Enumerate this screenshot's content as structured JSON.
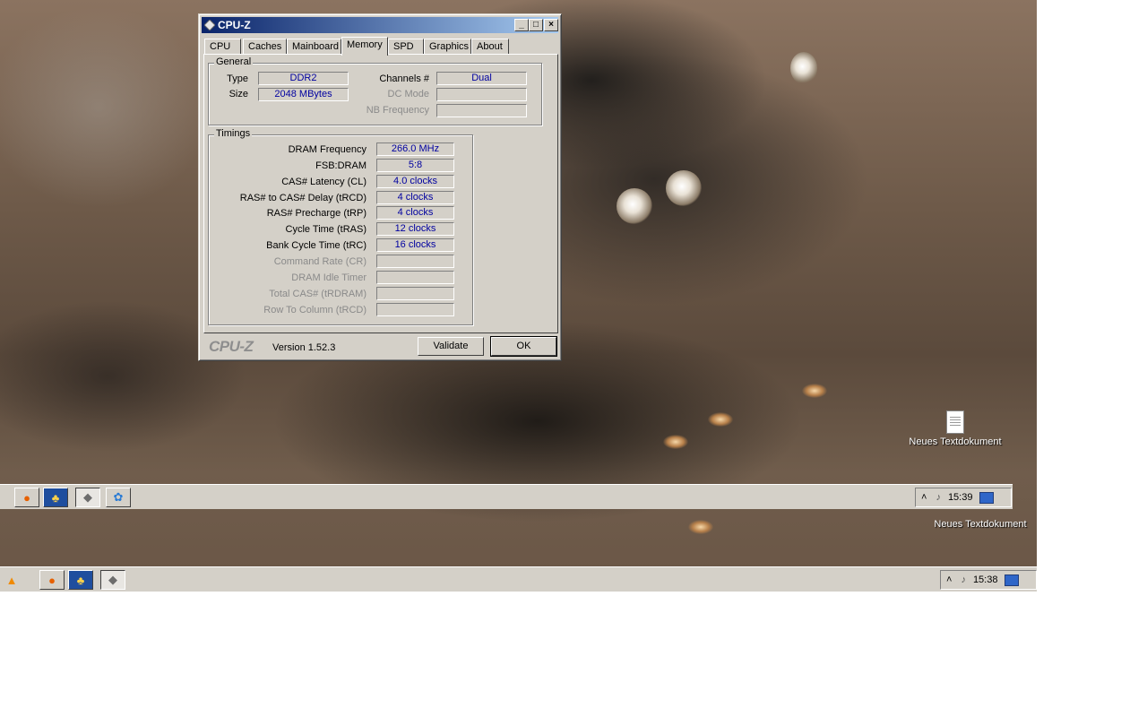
{
  "window": {
    "title": "CPU-Z",
    "tabs": [
      "CPU",
      "Caches",
      "Mainboard",
      "Memory",
      "SPD",
      "Graphics",
      "About"
    ],
    "active_tab": "Memory",
    "general": {
      "label": "General",
      "type_label": "Type",
      "type_value": "DDR2",
      "size_label": "Size",
      "size_value": "2048 MBytes",
      "channels_label": "Channels #",
      "channels_value": "Dual",
      "dc_mode_label": "DC Mode",
      "dc_mode_value": "",
      "nb_freq_label": "NB Frequency",
      "nb_freq_value": ""
    },
    "timings": {
      "label": "Timings",
      "rows": [
        {
          "label": "DRAM Frequency",
          "value": "266.0 MHz",
          "enabled": true
        },
        {
          "label": "FSB:DRAM",
          "value": "5:8",
          "enabled": true
        },
        {
          "label": "CAS# Latency (CL)",
          "value": "4.0 clocks",
          "enabled": true
        },
        {
          "label": "RAS# to CAS# Delay (tRCD)",
          "value": "4 clocks",
          "enabled": true
        },
        {
          "label": "RAS# Precharge (tRP)",
          "value": "4 clocks",
          "enabled": true
        },
        {
          "label": "Cycle Time (tRAS)",
          "value": "12 clocks",
          "enabled": true
        },
        {
          "label": "Bank Cycle Time (tRC)",
          "value": "16 clocks",
          "enabled": true
        },
        {
          "label": "Command Rate (CR)",
          "value": "",
          "enabled": false
        },
        {
          "label": "DRAM Idle Timer",
          "value": "",
          "enabled": false
        },
        {
          "label": "Total CAS# (tRDRAM)",
          "value": "",
          "enabled": false
        },
        {
          "label": "Row To Column (tRCD)",
          "value": "",
          "enabled": false
        }
      ]
    },
    "footer": {
      "logo": "CPU-Z",
      "version": "Version 1.52.3",
      "validate_label": "Validate",
      "ok_label": "OK"
    }
  },
  "desktop": {
    "icon_label_top": "Neues Textdokument",
    "icon_label_bottom": "Neues Textdokument"
  },
  "taskbar_upper": {
    "clock": "15:39",
    "buttons": [
      "firefox-icon",
      "messenger-icon",
      "cpuz-icon",
      "paint-icon"
    ]
  },
  "taskbar_lower": {
    "clock": "15:38",
    "buttons": [
      "vlc-icon",
      "firefox-icon",
      "messenger-icon",
      "cpuz-icon"
    ]
  }
}
